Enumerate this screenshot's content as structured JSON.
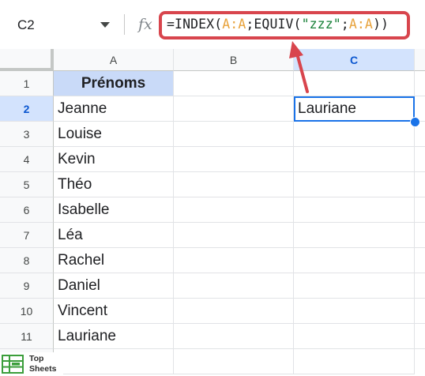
{
  "formula_bar": {
    "name_box": "C2",
    "fx_label": "fx",
    "formula_tokens": [
      "=INDEX(",
      "A:A",
      ";EQUIV(",
      "\"zzz\"",
      ";",
      "A:A",
      "))"
    ]
  },
  "columns": [
    "A",
    "B",
    "C"
  ],
  "rows": [
    {
      "num": "1",
      "a": "Prénoms",
      "c": ""
    },
    {
      "num": "2",
      "a": "Jeanne",
      "c": "Lauriane"
    },
    {
      "num": "3",
      "a": "Louise",
      "c": ""
    },
    {
      "num": "4",
      "a": "Kevin",
      "c": ""
    },
    {
      "num": "5",
      "a": "Théo",
      "c": ""
    },
    {
      "num": "6",
      "a": "Isabelle",
      "c": ""
    },
    {
      "num": "7",
      "a": "Léa",
      "c": ""
    },
    {
      "num": "8",
      "a": "Rachel",
      "c": ""
    },
    {
      "num": "9",
      "a": "Daniel",
      "c": ""
    },
    {
      "num": "10",
      "a": "Vincent",
      "c": ""
    },
    {
      "num": "11",
      "a": "Lauriane",
      "c": ""
    }
  ],
  "logo": {
    "line1": "Top",
    "line2": "Sheets"
  },
  "colors": {
    "selection": "#1a73e8",
    "header_fill": "#c9daf8",
    "highlight": "#d8454d",
    "reference": "#e8a33d",
    "string": "#188038"
  }
}
